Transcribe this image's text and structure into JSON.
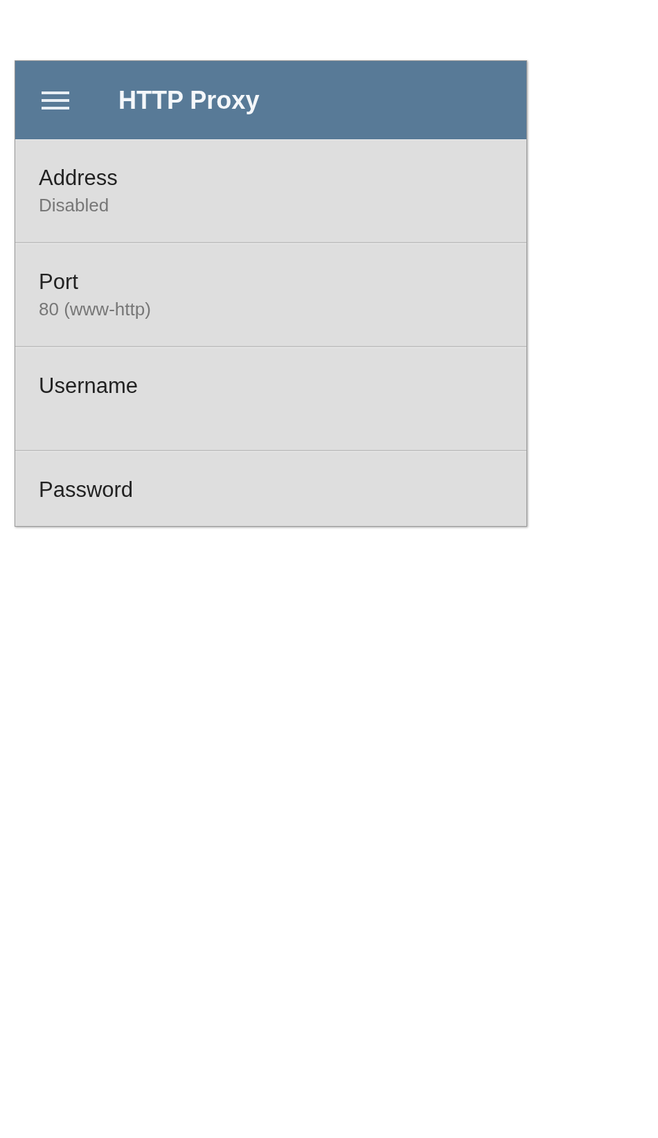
{
  "app_bar": {
    "title": "HTTP Proxy"
  },
  "settings": [
    {
      "label": "Address",
      "value": "Disabled"
    },
    {
      "label": "Port",
      "value": "80 (www-http)"
    },
    {
      "label": "Username"
    },
    {
      "label": "Password"
    }
  ]
}
